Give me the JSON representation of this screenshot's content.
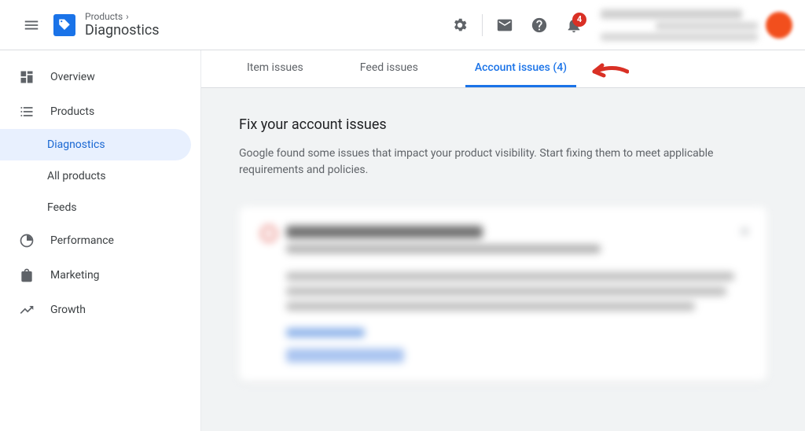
{
  "header": {
    "breadcrumb_parent": "Products",
    "breadcrumb_current": "Diagnostics",
    "notification_count": "4"
  },
  "sidebar": {
    "overview": "Overview",
    "products": "Products",
    "diagnostics": "Diagnostics",
    "all_products": "All products",
    "feeds": "Feeds",
    "performance": "Performance",
    "marketing": "Marketing",
    "growth": "Growth"
  },
  "tabs": {
    "item": "Item issues",
    "feed": "Feed issues",
    "account": "Account issues (4)"
  },
  "content": {
    "heading": "Fix your account issues",
    "description": "Google found some issues that impact your product visibility. Start fixing them to meet applicable requirements and policies."
  }
}
